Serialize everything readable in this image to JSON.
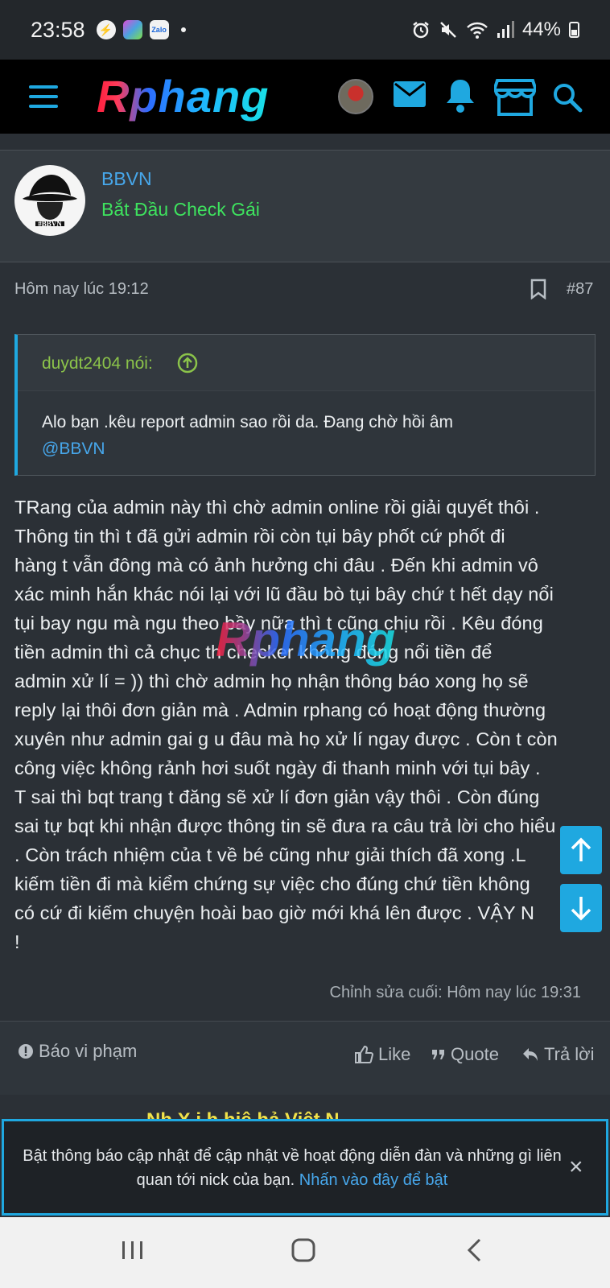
{
  "status_bar": {
    "time": "23:58",
    "battery": "44%",
    "icons": [
      "messenger-icon",
      "photos-icon",
      "zalo-icon",
      "alarm-icon",
      "mute-icon",
      "wifi-icon",
      "signal-icon",
      "battery-icon"
    ],
    "zalo_label": "Zalo"
  },
  "nav": {
    "logo": "Rphang",
    "icons": [
      "menu-icon",
      "avatar",
      "mail-icon",
      "bell-icon",
      "store-icon",
      "search-icon"
    ]
  },
  "member": {
    "name": "BBVN",
    "title": "Bắt Đầu Check Gái",
    "avatar_text": "#BBVN"
  },
  "post": {
    "timestamp": "Hôm nay lúc 19:12",
    "number": "#87",
    "quote": {
      "author": "duydt2404 nói:",
      "text": "Alo bạn .kêu report admin sao rồi da. Đang chờ hồi âm",
      "mention": "@BBVN"
    },
    "body_lines": [
      "TRang của admin này thì chờ admin online rồi giải quyết thôi .",
      "Thông tin thì t đã gửi admin rồi còn tụi bây phốt cứ phốt đi",
      "hàng t vẫn đông mà có ảnh hưởng chi đâu . Đến khi admin vô",
      "xác minh hắn khác nói lại với lũ đầu bò tụi bây chứ t hết dạy nổi",
      "tụi bay ngu mà ngu theo bầy nữa thì t cũng chịu rồi . Kêu đóng",
      "tiền admin thì cả chục th checker không đóng nổi tiền để",
      "admin xử lí = )) thì chờ admin họ nhận thông báo xong họ sẽ",
      "reply lại thôi đơn giản mà . Admin rphang có hoạt động thường",
      "xuyên như admin gai g u đâu mà họ xử lí ngay được . Còn t còn",
      "công việc không rảnh hơi suốt ngày đi thanh minh với tụi bây .",
      "T sai thì bqt trang t đăng sẽ xử lí đơn giản vậy thôi . Còn đúng",
      "sai tự bqt khi nhận được thông tin sẽ đưa ra câu trả lời cho hiểu",
      ". Còn trách nhiệm của t về bé cũng như giải thích đã xong .L",
      "kiếm tiền đi mà kiểm chứng sự việc cho đúng chứ tiền không",
      "có cứ đi kiếm chuyện hoài bao giờ mới khá lên được . VẬY N",
      "!"
    ],
    "watermark": "Rphang",
    "edited": "Chỉnh sửa cuối: Hôm nay lúc 19:31"
  },
  "actions": {
    "report": "Báo vi phạm",
    "like": "Like",
    "quote": "Quote",
    "reply": "Trả lời"
  },
  "peek_text": "Nh          X i h          hiệ  hả  Việt N",
  "notice": {
    "text": "Bật thông báo cập nhật để cập nhật về hoạt động diễn đàn và những gì liên quan tới nick của bạn.",
    "link": "Nhấn vào đây để bật",
    "close": "×"
  },
  "colors": {
    "accent": "#1fa8e0",
    "username": "#47a7eb",
    "user_title": "#3ee25e",
    "quote_author": "#8bc34a",
    "background": "#2b3036"
  }
}
